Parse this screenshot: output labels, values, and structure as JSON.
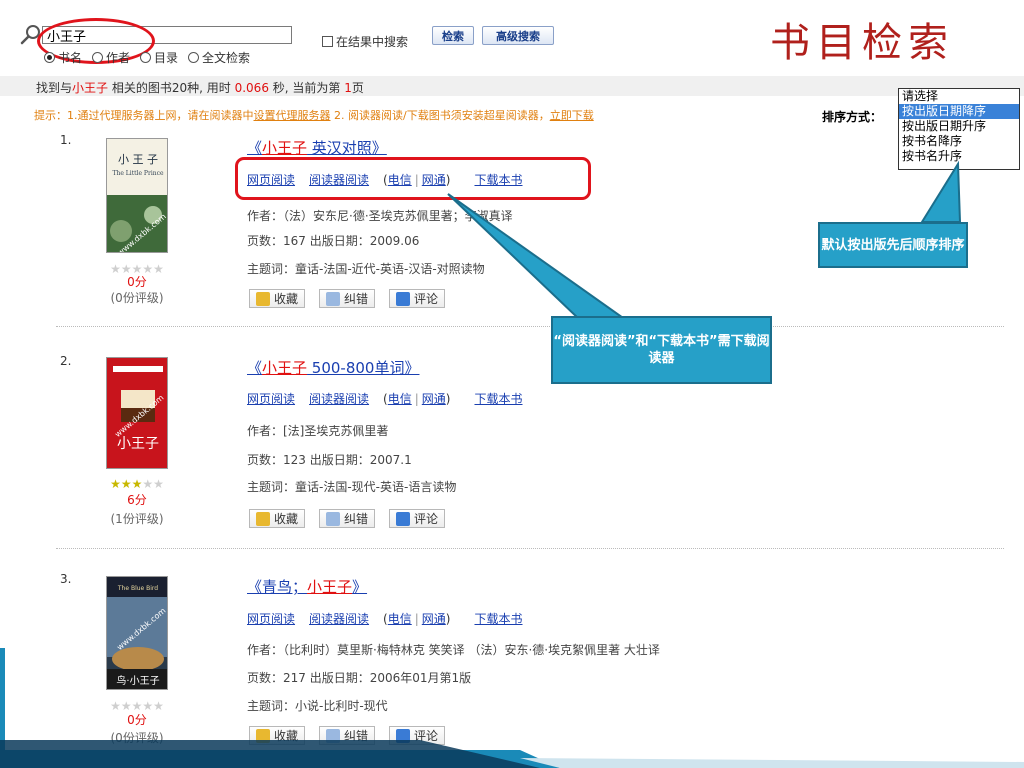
{
  "search": {
    "query": "小王子",
    "within_label": "在结果中搜索",
    "search_button": "检索",
    "advanced_button": "高级搜索",
    "options": [
      "书名",
      "作者",
      "目录",
      "全文检索"
    ],
    "selected_option": "书名"
  },
  "page_title": "书目检索",
  "result_summary": {
    "prefix": "找到与",
    "keyword": "小王子",
    "middle": "相关的图书20种, 用时",
    "time": "0.066",
    "suffix": "秒, 当前为第",
    "page": "1",
    "page_suffix": "页"
  },
  "hint": {
    "text1": "提示：1.通过代理服务器上网，请在阅读器中",
    "link1": "设置代理服务器",
    "text2": " 2. 阅读器阅读/下载图书须安装超星阅读器，",
    "link2": "立即下载"
  },
  "sort": {
    "label": "排序方式：",
    "options": [
      "请选择",
      "按出版日期降序",
      "按出版日期升序",
      "按书名降序",
      "按书名升序"
    ],
    "highlighted_index": 1
  },
  "link_labels": {
    "web_read": "网页阅读",
    "reader_read": "阅读器阅读",
    "telecom": "电信",
    "netcom": "网通",
    "download": "下载本书"
  },
  "action_labels": {
    "collect": "收藏",
    "correct": "纠错",
    "comment": "评论"
  },
  "books": [
    {
      "num": "1.",
      "title_prefix": "《",
      "title_highlight": "小王子",
      "title_rest": " 英汉对照》",
      "author": "作者：（法）安东尼·德·圣埃克苏佩里著；李淑真译",
      "pages_date": "页数：167   出版日期：2009.06",
      "subject": "主题词：童话-法国-近代-英语-汉语-对照读物",
      "stars": 0,
      "score": "0分",
      "votes": "(0份评级)"
    },
    {
      "num": "2.",
      "title_prefix": "《",
      "title_highlight": "小王子",
      "title_rest": " 500-800单词》",
      "author": "作者：[法]圣埃克苏佩里著",
      "pages_date": "页数：123   出版日期：2007.1",
      "subject": "主题词：童话-法国-现代-英语-语言读物",
      "stars": 3,
      "score": "6分",
      "votes": "(1份评级)"
    },
    {
      "num": "3.",
      "title_prefix": "《青鸟；",
      "title_highlight": "小王子",
      "title_rest": "》",
      "author": "作者：（比利时）莫里斯·梅特林克 笑笑译 （法）安东·德·埃克絮佩里著 大壮译",
      "pages_date": "页数：217   出版日期：2006年01月第1版",
      "subject": "主题词：小说-比利时-现代",
      "stars": 0,
      "score": "0分",
      "votes": "(0份评级)"
    }
  ],
  "callouts": {
    "reader_note": "“阅读器阅读”和“下载本书”需下载阅读器",
    "sort_note": "默认按出版先后顺序排序"
  }
}
